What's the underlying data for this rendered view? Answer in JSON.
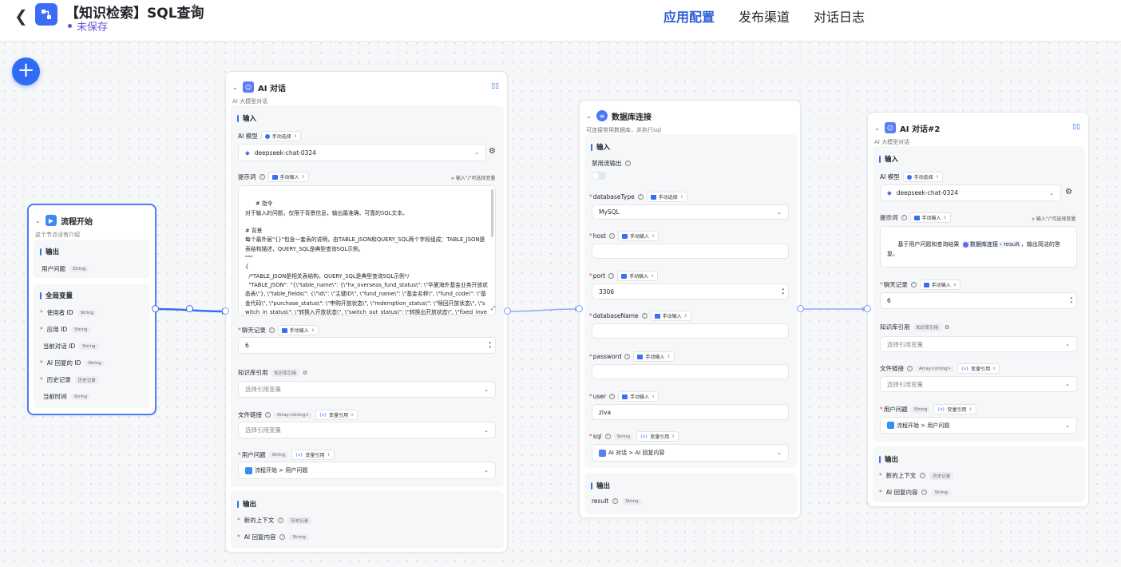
{
  "header": {
    "title": "【知识检索】SQL查询",
    "save_status": "未保存",
    "tabs": [
      {
        "label": "应用配置",
        "active": true
      },
      {
        "label": "发布渠道",
        "active": false
      },
      {
        "label": "对话日志",
        "active": false
      }
    ]
  },
  "colors": {
    "accent": "#2f6bf5",
    "active_tab": "#2f5fd9",
    "unsaved": "#6b4fd9"
  },
  "start_node": {
    "title": "流程开始",
    "subtitle": "这个节点没有介绍",
    "output_title": "输出",
    "outputs": [
      {
        "label": "用户问题",
        "type": "String"
      }
    ],
    "globals_title": "全局变量",
    "globals": [
      {
        "label": "使用者 ID",
        "type": "String",
        "required": true
      },
      {
        "label": "应用 ID",
        "type": "String",
        "required": true
      },
      {
        "label": "当前对话 ID",
        "type": "String",
        "required": false
      },
      {
        "label": "AI 回复的 ID",
        "type": "String",
        "required": true
      },
      {
        "label": "历史记录",
        "type": "历史记录",
        "required": true
      },
      {
        "label": "当前时间",
        "type": "String",
        "required": false
      }
    ]
  },
  "ai_node": {
    "title": "AI 对话",
    "subtitle": "AI 大模型对话",
    "input_title": "输入",
    "model_label": "AI 模型",
    "model_mode": "手动选择",
    "model_value": "deepseek-chat-0324",
    "prompt_label": "提示词",
    "prompt_mode": "手动输入",
    "prompt_hint": "输入\"/\"可选择变量",
    "prompt_text": "# 指令\n对于输入的问题，仅限于背景信息，输出最准确、可靠的SQL文本。\n\n# 背景\n每个最外层\"{}\"包含一套表的说明，由TABLE_JSON和QUERY_SQL两个字段组成：TABLE_JSON是表结构描述，QUERY_SQL是典型查询SQL示例。\n\"\"\"\n{\n  /*TABLE_JSON是相关表结构，QUERY_SQL是典型查询SQL示例*/\n  \"TABLE_JSON\": \"{\\\"table_name\\\": {\\\"hx_overseas_fund_status\\\": \\\"华夏海外基金业务开放状态表\\\"}, \\\"table_fields\\\": {\\\"id\\\": \\\"主键ID\\\", \\\"fund_name\\\": \\\"基金名称\\\", \\\"fund_code\\\": \\\"基金代码\\\", \\\"purchase_status\\\": \\\"申购开放状态\\\", \\\"redemption_status\\\": \\\"赎回开放状态\\\", \\\"switch_in_status\\\": \\\"转换入开放状态\\\", \\\"switch_out_status\\\": \\\"转换出开放状态\\\", \\\"fixed_investment_status\\\": \\\"定投开放状态\\\", \\\"create_time\\\": \\\"创建时间\\\",",
    "history_label": "聊天记录",
    "history_mode": "手动输入",
    "history_value": "6",
    "kb_label": "知识库引用",
    "kb_badge": "知识库引用",
    "kb_placeholder": "选择引用变量",
    "file_label": "文件链接",
    "file_badge": "Array<string>",
    "file_mode": "变量引用",
    "file_placeholder": "选择引用变量",
    "question_label": "用户问题",
    "question_badge": "String",
    "question_mode": "变量引用",
    "question_ref": "流程开始 > 用户问题",
    "output_title": "输出",
    "outputs": [
      {
        "label": "新的上下文",
        "type": "历史记录"
      },
      {
        "label": "AI 回复内容",
        "type": "String"
      }
    ]
  },
  "db_node": {
    "title": "数据库连接",
    "subtitle": "可连接常用数据库，并执行sql",
    "input_title": "输入",
    "stream_label": "禁用流输出",
    "fields": [
      {
        "key": "databaseType",
        "label": "databaseType",
        "mode": "手动选择",
        "value": "MySQL"
      },
      {
        "key": "host",
        "label": "host",
        "mode": "手动输入",
        "value": ""
      },
      {
        "key": "port",
        "label": "port",
        "mode": "手动输入",
        "value": "3306"
      },
      {
        "key": "databaseName",
        "label": "databaseName",
        "mode": "手动输入",
        "value": ""
      },
      {
        "key": "password",
        "label": "password",
        "mode": "手动输入",
        "value": ""
      },
      {
        "key": "user",
        "label": "user",
        "mode": "手动输入",
        "value": "ziva"
      }
    ],
    "sql_label": "sql",
    "sql_badge": "String",
    "sql_mode": "变量引用",
    "sql_ref": "AI 对话 > AI 回复内容",
    "output_title": "输出",
    "outputs": [
      {
        "label": "result",
        "type": "String"
      }
    ]
  },
  "ai_node2": {
    "title": "AI 对话#2",
    "subtitle": "AI 大模型对话",
    "input_title": "输入",
    "model_label": "AI 模型",
    "model_mode": "手动选择",
    "model_value": "deepseek-chat-0324",
    "prompt_label": "提示词",
    "prompt_mode": "手动输入",
    "prompt_hint": "输入\"/\"可选择变量",
    "prompt_pre": "基于用户问题和查询结果",
    "prompt_chip": "数据库连接 › result",
    "prompt_post": "，输出简洁的答复。",
    "history_label": "聊天记录",
    "history_mode": "手动输入",
    "history_value": "6",
    "kb_label": "知识库引用",
    "kb_badge": "知识库引用",
    "kb_placeholder": "选择引用变量",
    "file_label": "文件链接",
    "file_badge": "Array<string>",
    "file_mode": "变量引用",
    "file_placeholder": "选择引用变量",
    "question_label": "用户问题",
    "question_badge": "String",
    "question_mode": "变量引用",
    "question_ref": "流程开始 > 用户问题",
    "output_title": "输出",
    "outputs": [
      {
        "label": "新的上下文",
        "type": "历史记录"
      },
      {
        "label": "AI 回复内容",
        "type": "String"
      }
    ]
  }
}
